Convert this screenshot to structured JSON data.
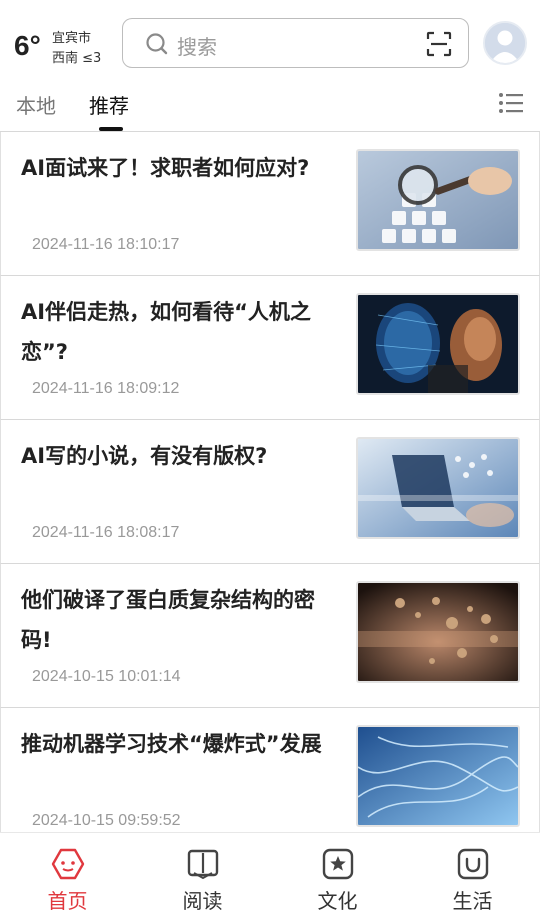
{
  "weather": {
    "temperature": "6°",
    "city": "宜宾市",
    "wind": "西南 ≤3"
  },
  "search": {
    "placeholder": "搜索"
  },
  "tabs": [
    {
      "label": "本地",
      "active": false
    },
    {
      "label": "推荐",
      "active": true
    }
  ],
  "articles": [
    {
      "title": "AI面试来了！求职者如何应对?",
      "time": "2024-11-16 18:10:17",
      "thumb_icon": "hiring-magnifier-image"
    },
    {
      "title": "AI伴侣走热，如何看待“人机之恋”?",
      "time": "2024-11-16 18:09:12",
      "thumb_icon": "ai-face-image"
    },
    {
      "title": "AI写的小说，有没有版权?",
      "time": "2024-11-16 18:08:17",
      "thumb_icon": "laptop-hologram-image"
    },
    {
      "title": "他们破译了蛋白质复杂结构的密码!",
      "time": "2024-10-15 10:01:14",
      "thumb_icon": "protein-particles-image"
    },
    {
      "title": "推动机器学习技术“爆炸式”发展",
      "time": "2024-10-15 09:59:52",
      "thumb_icon": "neural-fiber-image"
    }
  ],
  "bottom_nav": [
    {
      "label": "首页",
      "icon": "home-icon",
      "active": true
    },
    {
      "label": "阅读",
      "icon": "book-icon",
      "active": false
    },
    {
      "label": "文化",
      "icon": "culture-star-icon",
      "active": false
    },
    {
      "label": "生活",
      "icon": "life-bag-icon",
      "active": false
    }
  ],
  "colors": {
    "accent": "#e0383e",
    "text": "#222222",
    "muted": "#999999"
  }
}
